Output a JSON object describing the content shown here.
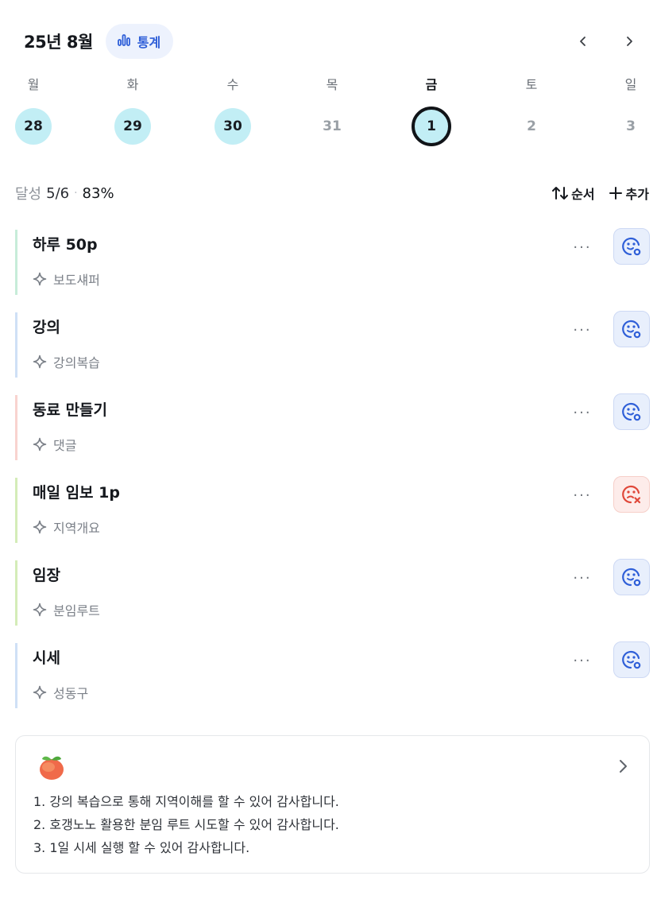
{
  "header": {
    "month_title": "25년 8월",
    "stats_label": "통계"
  },
  "week": {
    "days": [
      {
        "label": "월",
        "date": "28",
        "state": "done"
      },
      {
        "label": "화",
        "date": "29",
        "state": "done"
      },
      {
        "label": "수",
        "date": "30",
        "state": "done"
      },
      {
        "label": "목",
        "date": "31",
        "state": "none"
      },
      {
        "label": "금",
        "date": "1",
        "state": "selected"
      },
      {
        "label": "토",
        "date": "2",
        "state": "none"
      },
      {
        "label": "일",
        "date": "3",
        "state": "none"
      }
    ]
  },
  "summary": {
    "label": "달성",
    "count": "5/6",
    "percent": "83%",
    "sort_label": "순서",
    "add_label": "추가"
  },
  "habits": [
    {
      "title": "하루 50p",
      "subtitle": "보도섀퍼",
      "status": "ok",
      "accent": "#c7ecd9"
    },
    {
      "title": "강의",
      "subtitle": "강의복습",
      "status": "ok",
      "accent": "#cfe0f6"
    },
    {
      "title": "동료 만들기",
      "subtitle": "댓글",
      "status": "ok",
      "accent": "#f8d3cf"
    },
    {
      "title": "매일 임보 1p",
      "subtitle": "지역개요",
      "status": "fail",
      "accent": "#d4ecb8"
    },
    {
      "title": "임장",
      "subtitle": "분임루트",
      "status": "ok",
      "accent": "#d4ecb8"
    },
    {
      "title": "시세",
      "subtitle": "성동구",
      "status": "ok",
      "accent": "#cfe0f6"
    }
  ],
  "more_label": "···",
  "gratitude": {
    "icon": "peach-icon",
    "lines": [
      "1. 강의 복습으로 통해 지역이해를 할 수 있어 감사합니다.",
      "2. 호갱노노 활용한 분임 루트 시도할 수 있어 감사합니다.",
      "3. 1일 시세 실행 할 수 있어 감사합니다."
    ]
  },
  "colors": {
    "accent_blue": "#2f5fd8",
    "done_circle": "#c2eef5",
    "fail_red": "#e0483a"
  }
}
